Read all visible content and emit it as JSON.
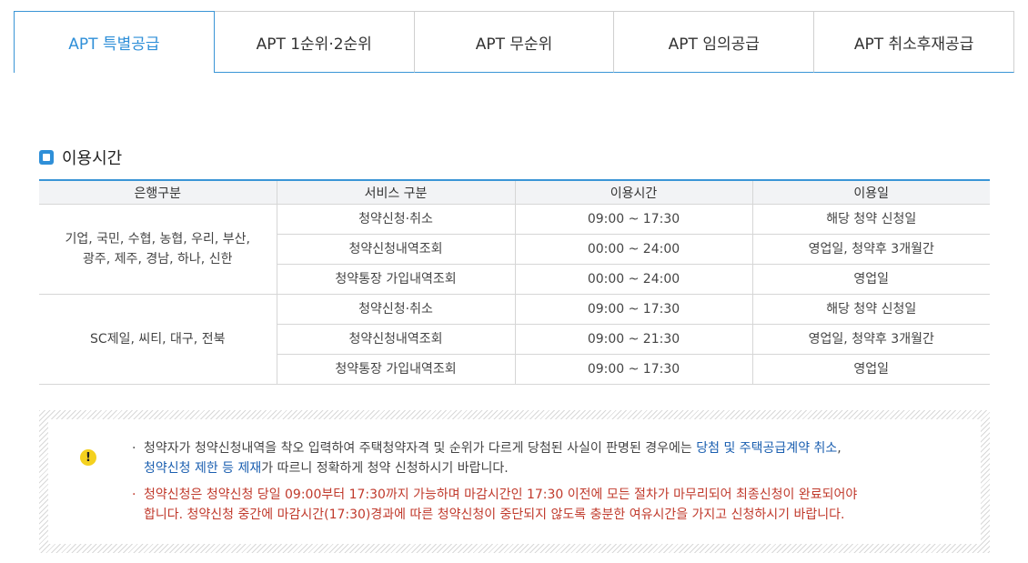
{
  "tabs": [
    {
      "label": "APT 특별공급",
      "active": true
    },
    {
      "label": "APT 1순위·2순위",
      "active": false
    },
    {
      "label": "APT 무순위",
      "active": false
    },
    {
      "label": "APT 임의공급",
      "active": false
    },
    {
      "label": "APT 취소후재공급",
      "active": false
    }
  ],
  "section": {
    "title": "이용시간",
    "icon": "square-bullet-icon"
  },
  "table": {
    "headers": [
      "은행구분",
      "서비스 구분",
      "이용시간",
      "이용일"
    ],
    "groups": [
      {
        "bank": [
          "기업, 국민, 수협, 농협, 우리, 부산,",
          "광주, 제주, 경남, 하나, 신한"
        ],
        "rows": [
          {
            "service": "청약신청·취소",
            "time": "09:00 ~ 17:30",
            "days": "해당 청약 신청일"
          },
          {
            "service": "청약신청내역조회",
            "time": "00:00 ~ 24:00",
            "days": "영업일, 청약후 3개월간"
          },
          {
            "service": "청약통장 가입내역조회",
            "time": "00:00 ~ 24:00",
            "days": "영업일"
          }
        ]
      },
      {
        "bank": [
          "SC제일, 씨티, 대구, 전북"
        ],
        "rows": [
          {
            "service": "청약신청·취소",
            "time": "09:00 ~ 17:30",
            "days": "해당 청약 신청일"
          },
          {
            "service": "청약신청내역조회",
            "time": "09:00 ~ 21:30",
            "days": "영업일, 청약후 3개월간"
          },
          {
            "service": "청약통장 가입내역조회",
            "time": "09:00 ~ 17:30",
            "days": "영업일"
          }
        ]
      }
    ]
  },
  "notice": {
    "icon": "exclamation-icon",
    "bullet": "·",
    "note1": {
      "line1_text": "청약자가 청약신청내역을 착오 입력하여 주택청약자격 및 순위가 다르게 당첨된 사실이 판명된 경우에는 ",
      "line1_link": "당첨 및 주택공급계약 취소",
      "line1_end": ",",
      "line2_link": "청약신청 제한 등 제재",
      "line2_text": "가 따르니 정확하게 청약 신청하시기 바랍니다."
    },
    "note2": {
      "line1": "청약신청은 청약신청 당일 09:00부터 17:30까지 가능하며 마감시간인 17:30 이전에 모든 절차가 마무리되어 최종신청이 완료되어야",
      "line2": "합니다. 청약신청 중간에 마감시간(17:30)경과에 따른 청약신청이 중단되지 않도록 충분한 여유시간을 가지고 신청하시기 바랍니다."
    }
  },
  "colors": {
    "accent": "#2f8fd8",
    "warning": "#c0392b",
    "link": "#1b5fb0",
    "header_bg": "#f2f3f5"
  }
}
